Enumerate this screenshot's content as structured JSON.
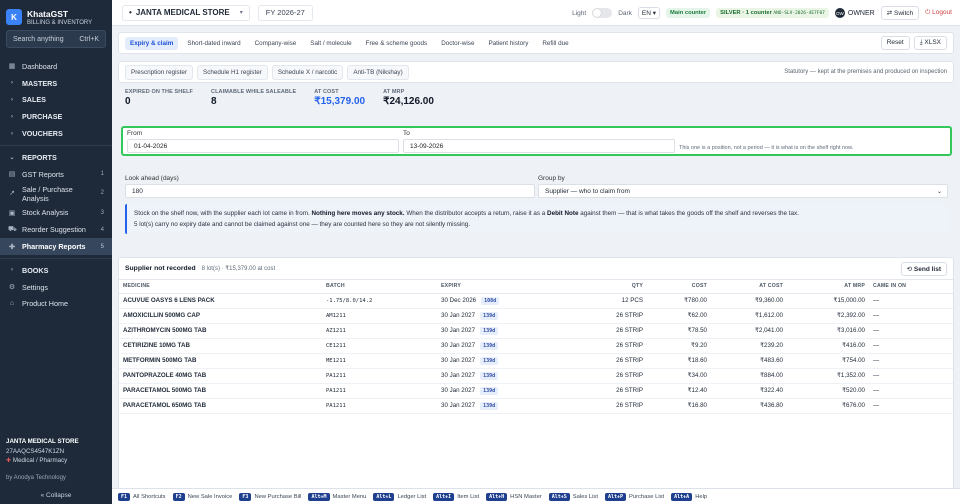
{
  "brand": {
    "name": "KhataGST",
    "subtitle": "BILLING & INVENTORY",
    "logo": "K"
  },
  "search": {
    "placeholder": "Search anything",
    "shortcut": "Ctrl+K"
  },
  "sidebar": {
    "items": [
      {
        "label": "Dashboard",
        "icon": "grid-icon"
      },
      {
        "label": "MASTERS",
        "group": true
      },
      {
        "label": "SALES",
        "group": true
      },
      {
        "label": "PURCHASE",
        "group": true
      },
      {
        "label": "VOUCHERS",
        "group": true
      },
      {
        "label": "REPORTS",
        "group": true,
        "expanded": true
      },
      {
        "label": "GST Reports",
        "badge": "1"
      },
      {
        "label": "Sale / Purchase Analysis",
        "badge": "2"
      },
      {
        "label": "Stock Analysis",
        "badge": "3"
      },
      {
        "label": "Reorder Suggestion",
        "badge": "4"
      },
      {
        "label": "Pharmacy Reports",
        "badge": "5",
        "active": true
      },
      {
        "label": "BOOKS",
        "group": true
      },
      {
        "label": "Settings"
      },
      {
        "label": "Product Home"
      }
    ],
    "company_name": "JANTA MEDICAL STORE",
    "gstin": "27AAQCS4547K1ZN",
    "company_type": "Medical / Pharmacy",
    "vendor": "by Anodya Technology",
    "collapse": "« Collapse"
  },
  "topbar": {
    "company": "JANTA MEDICAL STORE",
    "fy": "FY 2026-27",
    "theme_light": "Light",
    "theme_dark": "Dark",
    "lang": "EN",
    "main_counter": "Main counter",
    "plan": "SILVER · 1 counter",
    "plan_code": "ANO-SLV-2026-4E7F07",
    "owner": "OWNER",
    "switch": "Switch",
    "logout": "Logout"
  },
  "tabs": {
    "primary": [
      "Expiry & claim",
      "Short-dated inward",
      "Company-wise",
      "Salt / molecule",
      "Free & scheme goods",
      "Doctor-wise",
      "Patient history",
      "Refill due"
    ],
    "reset": "Reset",
    "xlsx": "XLSX",
    "secondary": [
      "Prescription register",
      "Schedule H1 register",
      "Schedule X / narcotic",
      "Anti-TB (Nikshay)"
    ],
    "statutory_note": "Statutory — kept at the premises and produced on inspection"
  },
  "stats": [
    {
      "label": "EXPIRED ON THE SHELF",
      "value": "0"
    },
    {
      "label": "CLAIMABLE WHILE SALEABLE",
      "value": "8"
    },
    {
      "label": "AT COST",
      "value": "₹15,379.00"
    },
    {
      "label": "AT MRP",
      "value": "₹24,126.00"
    }
  ],
  "filters": {
    "from_label": "From",
    "from_value": "01-04-2026",
    "to_label": "To",
    "to_value": "13-09-2026",
    "position_hint": "This one is a position, not a period — it is what is on the shelf right now.",
    "lookahead_label": "Look ahead (days)",
    "lookahead_value": "180",
    "group_label": "Group by",
    "group_value": "Supplier — who to claim from"
  },
  "info": {
    "p1": "Stock on the shelf now, with the supplier each lot came in from.",
    "p1b": "Nothing here moves any stock.",
    "p1c": "When the distributor accepts a return, raise it as a",
    "p1d": "Debit Note",
    "p1e": "against them — that is what takes the goods off the shelf and reverses the tax.",
    "p2": "5 lot(s) carry no expiry date and cannot be claimed against one — they are counted here so they are not silently missing."
  },
  "table": {
    "title": "Supplier not recorded",
    "subtitle": "8 lot(s) · ₹15,379.00 at cost",
    "send": "Send list",
    "headers": [
      "MEDICINE",
      "BATCH",
      "EXPIRY",
      "QTY",
      "COST",
      "AT COST",
      "AT MRP",
      "CAME IN ON"
    ],
    "rows": [
      {
        "medicine": "ACUVUE OASYS 6 LENS PACK",
        "batch": "-1.75/8.0/14.2",
        "expiry": "30 Dec 2026",
        "days": "108d",
        "qty": "12 PCS",
        "cost": "₹780.00",
        "at_cost": "₹9,360.00",
        "at_mrp": "₹15,000.00",
        "came_in": "—"
      },
      {
        "medicine": "AMOXICILLIN 500MG CAP",
        "batch": "AM1211",
        "expiry": "30 Jan 2027",
        "days": "139d",
        "qty": "26 STRIP",
        "cost": "₹62.00",
        "at_cost": "₹1,612.00",
        "at_mrp": "₹2,392.00",
        "came_in": "—"
      },
      {
        "medicine": "AZITHROMYCIN 500MG TAB",
        "batch": "AZ1211",
        "expiry": "30 Jan 2027",
        "days": "139d",
        "qty": "26 STRIP",
        "cost": "₹78.50",
        "at_cost": "₹2,041.00",
        "at_mrp": "₹3,016.00",
        "came_in": "—"
      },
      {
        "medicine": "CETIRIZINE 10MG TAB",
        "batch": "CE1211",
        "expiry": "30 Jan 2027",
        "days": "139d",
        "qty": "26 STRIP",
        "cost": "₹9.20",
        "at_cost": "₹239.20",
        "at_mrp": "₹416.00",
        "came_in": "—"
      },
      {
        "medicine": "METFORMIN 500MG TAB",
        "batch": "ME1211",
        "expiry": "30 Jan 2027",
        "days": "139d",
        "qty": "26 STRIP",
        "cost": "₹18.60",
        "at_cost": "₹483.60",
        "at_mrp": "₹754.00",
        "came_in": "—"
      },
      {
        "medicine": "PANTOPRAZOLE 40MG TAB",
        "batch": "PA1211",
        "expiry": "30 Jan 2027",
        "days": "139d",
        "qty": "26 STRIP",
        "cost": "₹34.00",
        "at_cost": "₹884.00",
        "at_mrp": "₹1,352.00",
        "came_in": "—"
      },
      {
        "medicine": "PARACETAMOL 500MG TAB",
        "batch": "PA1211",
        "expiry": "30 Jan 2027",
        "days": "139d",
        "qty": "26 STRIP",
        "cost": "₹12.40",
        "at_cost": "₹322.40",
        "at_mrp": "₹520.00",
        "came_in": "—"
      },
      {
        "medicine": "PARACETAMOL 650MG TAB",
        "batch": "PA1211",
        "expiry": "30 Jan 2027",
        "days": "139d",
        "qty": "26 STRIP",
        "cost": "₹16.80",
        "at_cost": "₹436.80",
        "at_mrp": "₹676.00",
        "came_in": "—"
      }
    ]
  },
  "shortcuts": [
    {
      "key": "F1",
      "label": "All Shortcuts"
    },
    {
      "key": "F2",
      "label": "New Sale Invoice"
    },
    {
      "key": "F3",
      "label": "New Purchase Bill"
    },
    {
      "key": "Alt+M",
      "label": "Master Menu"
    },
    {
      "key": "Alt+L",
      "label": "Ledger List"
    },
    {
      "key": "Alt+I",
      "label": "Item List"
    },
    {
      "key": "Alt+H",
      "label": "HSN Master"
    },
    {
      "key": "Alt+S",
      "label": "Sales List"
    },
    {
      "key": "Alt+P",
      "label": "Purchase List"
    },
    {
      "key": "Alt+A",
      "label": "Help"
    }
  ]
}
